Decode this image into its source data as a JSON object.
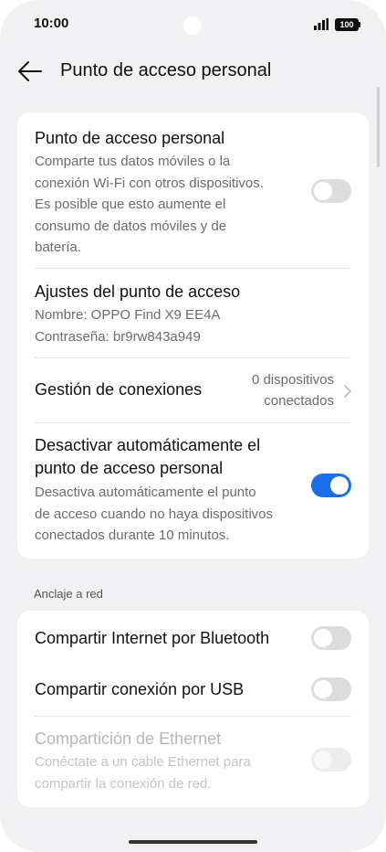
{
  "status_bar": {
    "time": "10:00",
    "battery": "100",
    "signal_icon": "cellular-signal-icon"
  },
  "header": {
    "title": "Punto de acceso personal",
    "back_icon": "arrow-left-icon"
  },
  "hotspot_card": {
    "hotspot": {
      "title": "Punto de acceso personal",
      "description_lines": [
        "Comparte tus datos móviles o la",
        "conexión Wi-Fi con otros dispositivos.",
        "Es posible que esto aumente el",
        "consumo de datos móviles y de",
        "batería."
      ],
      "enabled": false
    },
    "settings": {
      "title": "Ajustes del punto de acceso",
      "name_line": "Nombre: OPPO Find X9 EE4A",
      "password_line": "Contraseña: br9rw843a949"
    },
    "connections": {
      "title": "Gestión de conexiones",
      "value_line1": "0 dispositivos",
      "value_line2": "conectados"
    },
    "auto_off": {
      "title_line1": "Desactivar automáticamente el",
      "title_line2": "punto de acceso personal",
      "description_lines": [
        "Desactiva automáticamente el punto",
        "de acceso cuando no haya dispositivos",
        "conectados durante 10 minutos."
      ],
      "enabled": true
    }
  },
  "tethering": {
    "section_label": "Anclaje a red",
    "bluetooth": {
      "title": "Compartir Internet por Bluetooth",
      "enabled": false
    },
    "usb": {
      "title": "Compartir conexión por USB",
      "enabled": false
    },
    "ethernet": {
      "title": "Compartición de Ethernet",
      "description_lines": [
        "Conéctate a un cable Ethernet para",
        "compartir la conexión de red."
      ],
      "enabled": false,
      "disabled": true
    }
  },
  "colors": {
    "accent": "#1a6fe8",
    "background": "#f1f1f3",
    "card": "#ffffff",
    "toggle_off": "#dcdcdf"
  }
}
